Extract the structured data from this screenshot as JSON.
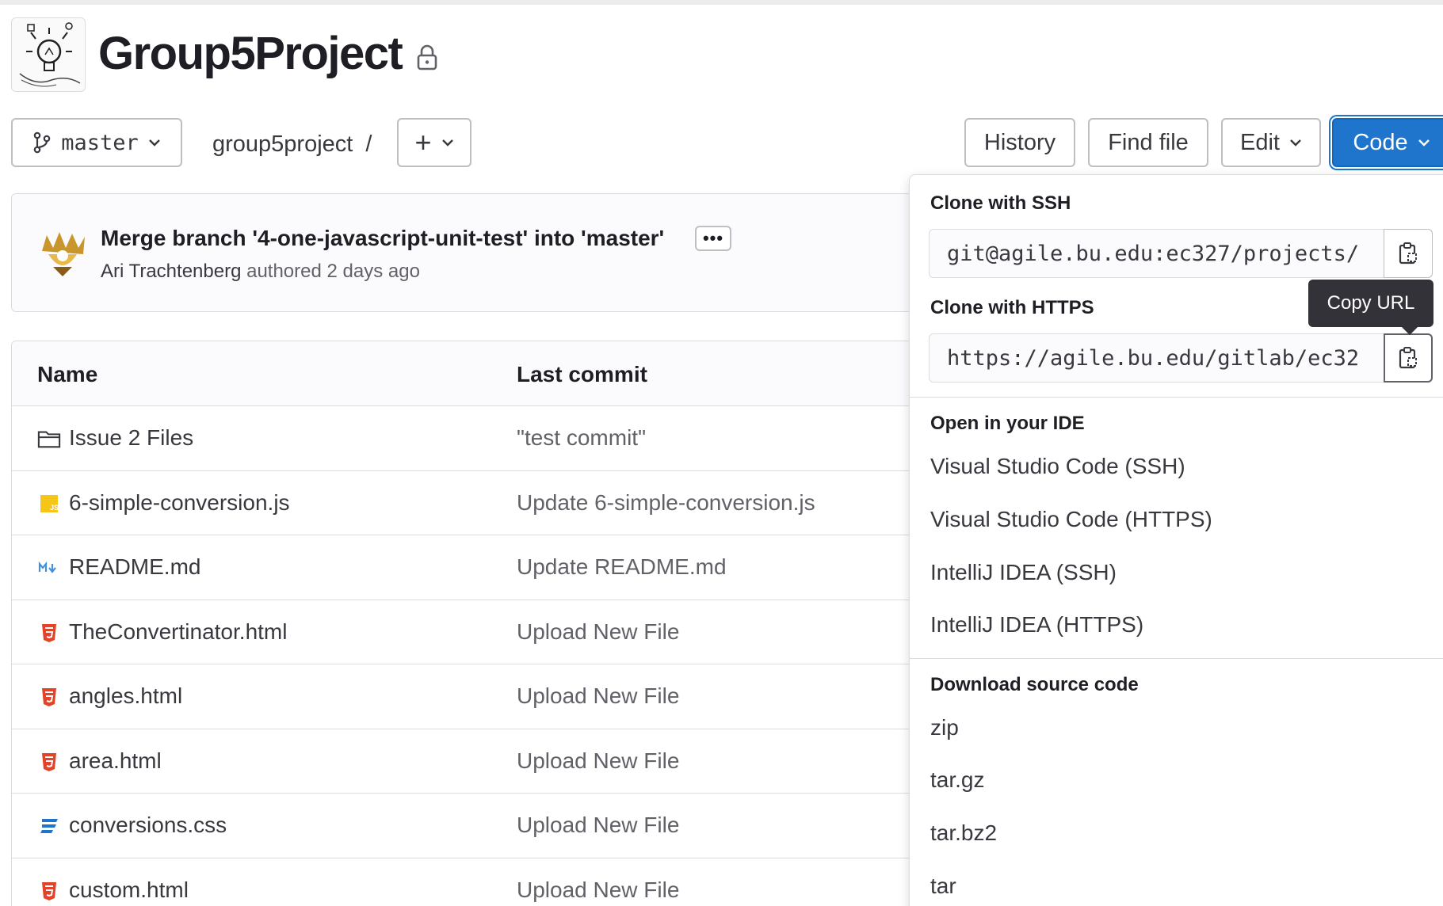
{
  "project": {
    "title": "Group5Project",
    "avatar_icon": "lightbulb-logo",
    "visibility_icon": "lock-icon"
  },
  "toolbar": {
    "branch": "master",
    "breadcrumb_path": "group5project",
    "breadcrumb_sep": "/",
    "add_label": "+",
    "history_label": "History",
    "find_file_label": "Find file",
    "edit_label": "Edit",
    "code_label": "Code"
  },
  "commit": {
    "title": "Merge branch '4-one-javascript-unit-test' into 'master'",
    "more_label": "•••",
    "author": "Ari Trachtenberg",
    "meta": "authored 2 days ago"
  },
  "table": {
    "headers": {
      "name": "Name",
      "last_commit": "Last commit"
    },
    "rows": [
      {
        "icon": "folder-icon",
        "name": "Issue 2 Files",
        "commit": "\"test commit\""
      },
      {
        "icon": "js-file-icon",
        "name": "6-simple-conversion.js",
        "commit": "Update 6-simple-conversion.js"
      },
      {
        "icon": "markdown-file-icon",
        "name": "README.md",
        "commit": "Update README.md"
      },
      {
        "icon": "html-file-icon",
        "name": "TheConvertinator.html",
        "commit": "Upload New File"
      },
      {
        "icon": "html-file-icon",
        "name": "angles.html",
        "commit": "Upload New File"
      },
      {
        "icon": "html-file-icon",
        "name": "area.html",
        "commit": "Upload New File"
      },
      {
        "icon": "css-file-icon",
        "name": "conversions.css",
        "commit": "Upload New File"
      },
      {
        "icon": "html-file-icon",
        "name": "custom.html",
        "commit": "Upload New File"
      }
    ]
  },
  "code_dropdown": {
    "ssh_title": "Clone with SSH",
    "ssh_url": "git@agile.bu.edu:ec327/projects/",
    "https_title": "Clone with HTTPS",
    "https_url": "https://agile.bu.edu/gitlab/ec32",
    "tooltip": "Copy URL",
    "ide_title": "Open in your IDE",
    "ide_items": [
      "Visual Studio Code (SSH)",
      "Visual Studio Code (HTTPS)",
      "IntelliJ IDEA (SSH)",
      "IntelliJ IDEA (HTTPS)"
    ],
    "download_title": "Download source code",
    "download_items": [
      "zip",
      "tar.gz",
      "tar.bz2",
      "tar"
    ]
  },
  "colors": {
    "primary": "#1f75cb",
    "html_icon": "#e24329",
    "css_icon": "#1f75cb",
    "js_icon": "#f5c518",
    "markdown_icon": "#428fdc"
  }
}
